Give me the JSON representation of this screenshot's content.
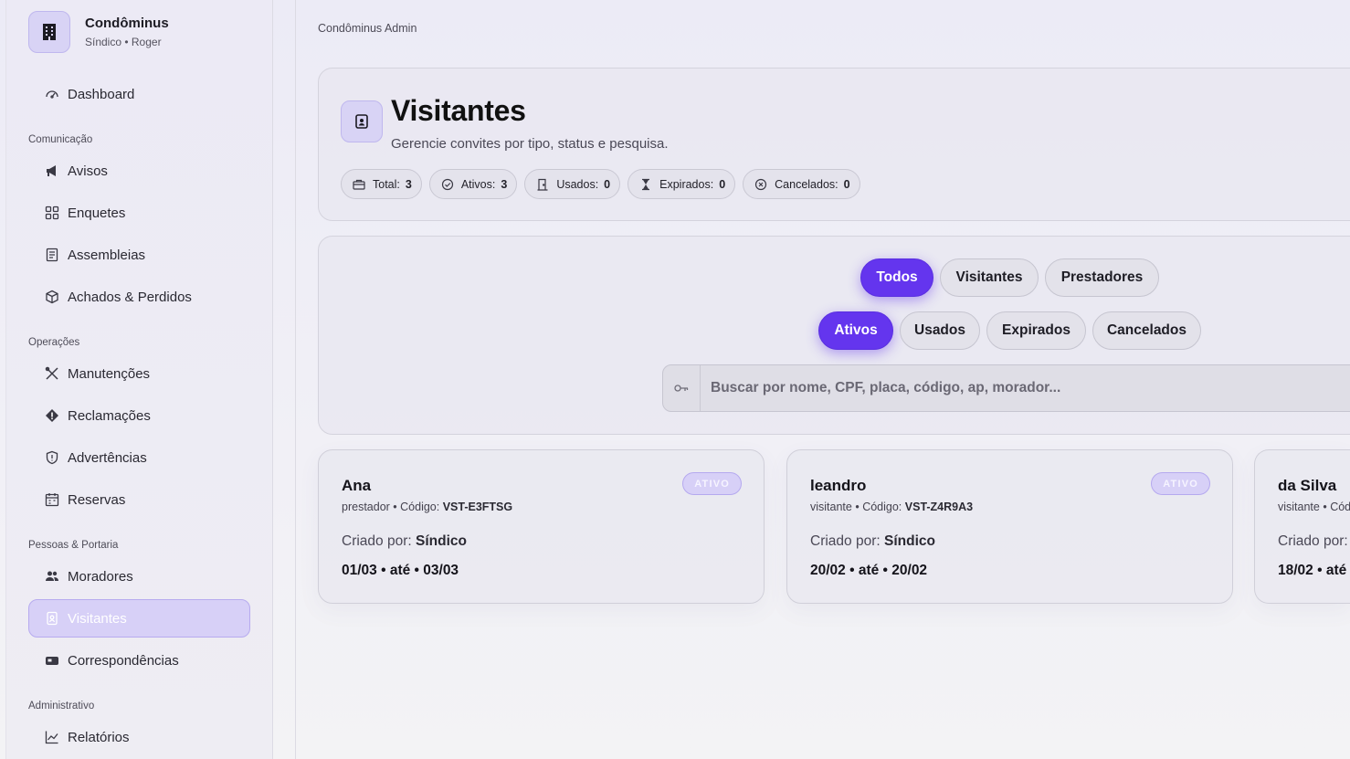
{
  "brand": {
    "name": "Condôminus",
    "subtitle": "Síndico • Roger"
  },
  "sidebar": {
    "dashboard": "Dashboard",
    "sections": {
      "comunicacao": "Comunicação",
      "operacoes": "Operações",
      "pessoas": "Pessoas & Portaria",
      "administrativo": "Administrativo"
    },
    "items": {
      "avisos": "Avisos",
      "enquetes": "Enquetes",
      "assembleias": "Assembleias",
      "achados": "Achados & Perdidos",
      "manutencoes": "Manutenções",
      "reclamacoes": "Reclamações",
      "advertencias": "Advertências",
      "reservas": "Reservas",
      "moradores": "Moradores",
      "visitantes": "Visitantes",
      "correspondencias": "Correspondências",
      "relatorios": "Relatórios"
    },
    "active_item": "visitantes"
  },
  "breadcrumb": "Condôminus Admin",
  "header": {
    "title": "Visitantes",
    "subtitle": "Gerencie convites por tipo, status e pesquisa.",
    "stats": [
      {
        "label": "Total:",
        "value": "3",
        "icon": "briefcase-icon"
      },
      {
        "label": "Ativos:",
        "value": "3",
        "icon": "check-circle-icon"
      },
      {
        "label": "Usados:",
        "value": "0",
        "icon": "door-icon"
      },
      {
        "label": "Expirados:",
        "value": "0",
        "icon": "hourglass-icon"
      },
      {
        "label": "Cancelados:",
        "value": "0",
        "icon": "x-circle-icon"
      }
    ]
  },
  "filters": {
    "type_tabs": [
      "Todos",
      "Visitantes",
      "Prestadores"
    ],
    "type_selected": "Todos",
    "status_tabs": [
      "Ativos",
      "Usados",
      "Expirados",
      "Cancelados"
    ],
    "status_selected": "Ativos",
    "search": {
      "placeholder": "Buscar por nome, CPF, placa, código, ap, morador...",
      "value": ""
    }
  },
  "visitors": [
    {
      "name": "Ana",
      "type": "prestador",
      "code_label": "Código:",
      "code": "VST-E3FTSG",
      "created_by_label": "Criado por:",
      "created_by": "Síndico",
      "dates": "01/03 • até • 03/03",
      "status": "ATIVO"
    },
    {
      "name": "leandro",
      "type": "visitante",
      "code_label": "Código:",
      "code": "VST-Z4R9A3",
      "created_by_label": "Criado por:",
      "created_by": "Síndico",
      "dates": "20/02 • até • 20/02",
      "status": "ATIVO"
    },
    {
      "name": "da Silva",
      "type": "visitante",
      "code_label": "Código:",
      "code": "",
      "created_by_label": "Criado por:",
      "created_by": "",
      "dates": "18/02 • até",
      "status": ""
    }
  ],
  "colors": {
    "accent": "#6435ee",
    "accent_soft": "#d7d0f7"
  }
}
